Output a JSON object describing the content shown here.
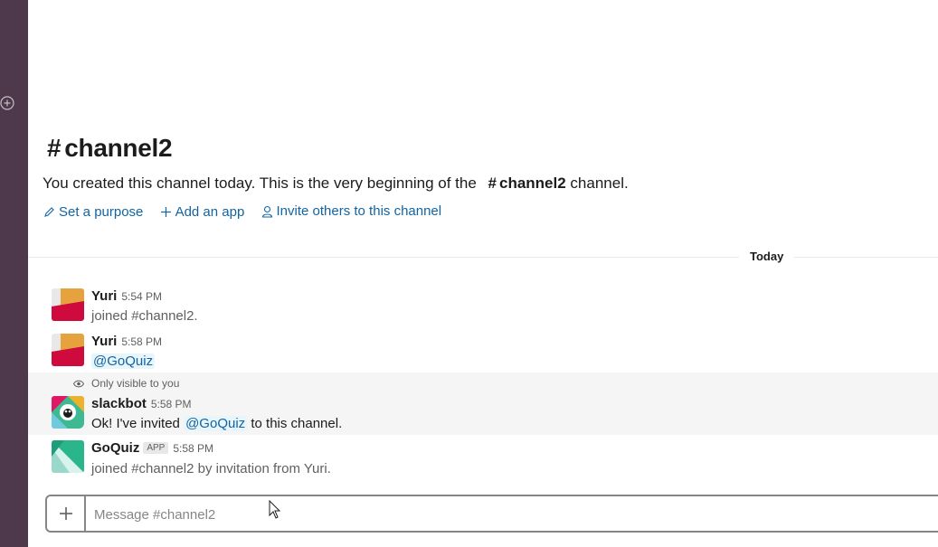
{
  "sidebar": {
    "add_icon": "circle-plus-icon"
  },
  "channel": {
    "hash": "#",
    "name": "channel2",
    "intro_prefix": "You created this channel today. This is the very beginning of the",
    "intro_channel": "channel2",
    "intro_suffix": "channel."
  },
  "actions": {
    "set_purpose": "Set a purpose",
    "add_app": "Add an app",
    "invite": "Invite others to this channel"
  },
  "divider": {
    "label": "Today"
  },
  "messages": [
    {
      "sender": "Yuri",
      "time": "5:54 PM",
      "text": "joined #channel2."
    },
    {
      "sender": "Yuri",
      "time": "5:58 PM",
      "mention": "@GoQuiz"
    },
    {
      "visibility": "Only visible to you",
      "sender": "slackbot",
      "time": "5:58 PM",
      "text_before": "Ok! I've invited",
      "mention": "@GoQuiz",
      "text_after": "to this channel."
    },
    {
      "sender": "GoQuiz",
      "badge": "APP",
      "time": "5:58 PM",
      "text": "joined #channel2 by invitation from Yuri."
    }
  ],
  "composer": {
    "placeholder": "Message #channel2",
    "value": ""
  },
  "colors": {
    "sidebar": "#4d394b",
    "link": "#1264a3",
    "mention_bg": "#e8f5fa"
  }
}
